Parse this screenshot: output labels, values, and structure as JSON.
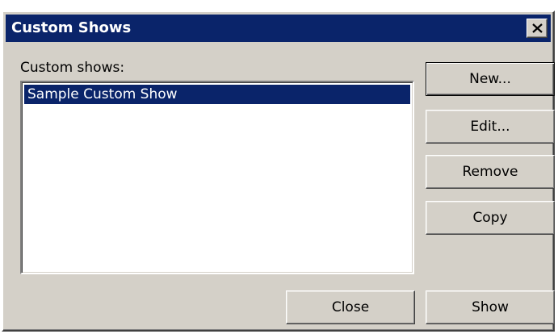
{
  "window": {
    "title": "Custom Shows",
    "close_icon": "close-icon"
  },
  "list": {
    "label": "Custom shows:",
    "items": [
      {
        "label": "Sample Custom Show",
        "selected": true
      }
    ]
  },
  "buttons": {
    "new": "New...",
    "edit": "Edit...",
    "remove": "Remove",
    "copy": "Copy",
    "close": "Close",
    "show": "Show"
  },
  "colors": {
    "titlebar": "#0a246a",
    "face": "#d4d0c8",
    "selection": "#0a246a"
  }
}
